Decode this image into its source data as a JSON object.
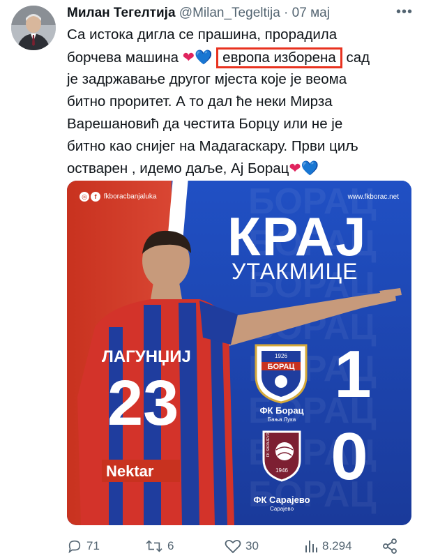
{
  "author": {
    "name": "Милан Тегелтија",
    "handle": "@Milan_Tegeltija",
    "separator": "·",
    "date": "07 мај"
  },
  "more_icon": "more-horizontal-icon",
  "text": {
    "line1": "Са истока дигла се прашина, прорадила",
    "line2_start": "борчева машина",
    "line2_highlight": "европа изборена",
    "line2_end": "сад",
    "line3": "је задржавање другог мјеста које је веома",
    "line4": "битно проритет. А то дал ће неки Мирза",
    "line5": "Варешановић да честита Борцу или не је",
    "line6": "битно као снијег на Мадагаскару. Први циљ",
    "line7_start": "остварен , идемо даље, Ај Борац",
    "heart_red": "❤",
    "heart_blue": "💙"
  },
  "media": {
    "social_handle": "fkboracbanjaluka",
    "website": "www.fkborac.net",
    "title": "КРАЈ",
    "subtitle": "УТАКМИЦЕ",
    "player_name": "ЛАГУНЏИЈ",
    "player_number": "23",
    "sponsor": "Nektar",
    "home_team": "ФК Борац",
    "home_city": "Бања Лука",
    "home_score": "1",
    "away_team": "ФК Сарајево",
    "away_city": "Сарајево",
    "away_score": "0",
    "crest_home_year": "1926",
    "crest_home_label": "БОРАЦ",
    "crest_away_year": "1946",
    "crest_away_label": "FK SARAJEVO",
    "watermark": "БОРАЦ"
  },
  "actions": {
    "replies": "71",
    "reposts": "6",
    "likes": "30",
    "views": "8.294"
  },
  "colors": {
    "highlight_border": "#e8321f",
    "secondary_text": "#536471",
    "club_red": "#c8321f",
    "club_blue": "#1e3f9e"
  }
}
